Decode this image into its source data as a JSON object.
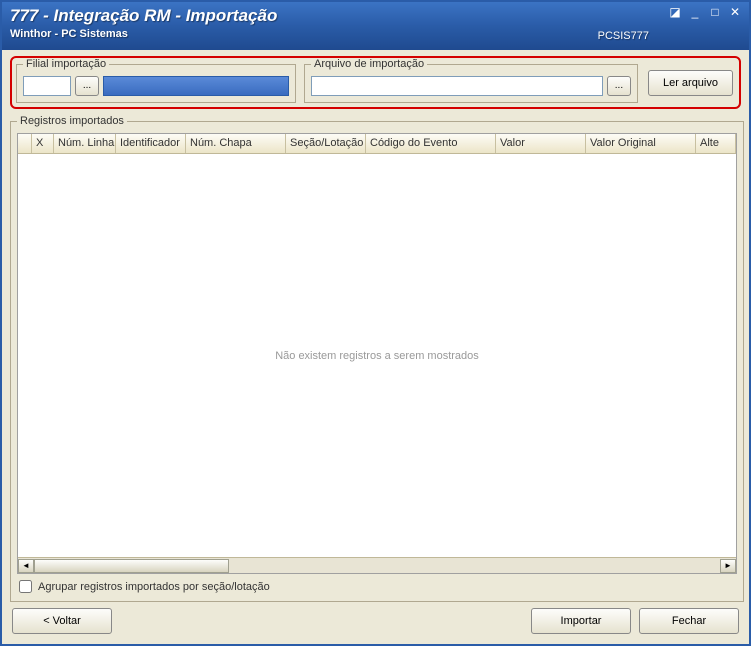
{
  "window": {
    "title": "777 - Integração RM - Importação",
    "subtitle": "Winthor - PC Sistemas",
    "code": "PCSIS777"
  },
  "groups": {
    "filial_label": "Filial importação",
    "arquivo_label": "Arquivo de importação",
    "records_label": "Registros importados"
  },
  "inputs": {
    "filial_code": "",
    "arquivo_path": ""
  },
  "buttons": {
    "ellipsis": "...",
    "read_file": "Ler arquivo",
    "back": "< Voltar",
    "import": "Importar",
    "close": "Fechar"
  },
  "grid": {
    "columns": {
      "x": "X",
      "linha": "Núm. Linha",
      "ident": "Identificador",
      "chapa": "Núm. Chapa",
      "secao": "Seção/Lotação",
      "evento": "Código do Evento",
      "valor": "Valor",
      "orig": "Valor Original",
      "alt": "Alte"
    },
    "empty_message": "Não existem registros a serem mostrados"
  },
  "checkbox": {
    "group_label": "Agrupar registros importados por seção/lotação",
    "checked": false
  }
}
